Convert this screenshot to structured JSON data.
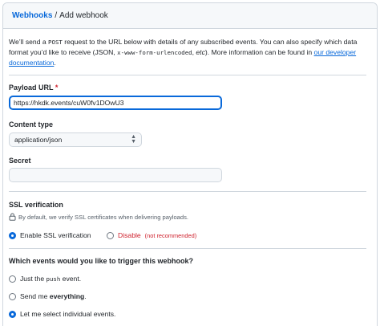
{
  "breadcrumb": {
    "parent": "Webhooks",
    "separator": "/",
    "current": "Add webhook"
  },
  "intro": {
    "t1": "We’ll send a ",
    "code_post": "POST",
    "t2": " request to the URL below with details of any subscribed events. You can also specify which data format you’d like to receive (JSON, ",
    "code_form": "x-www-form-urlencoded",
    "t3": ", ",
    "etc": "etc",
    "t4": "). More information can be found in ",
    "link": "our developer documentation",
    "t5": "."
  },
  "payload_url": {
    "label": "Payload URL",
    "required_mark": "*",
    "value": "https://hkdk.events/cuW0fv1DOwU3"
  },
  "content_type": {
    "label": "Content type",
    "selected": "application/json"
  },
  "secret": {
    "label": "Secret",
    "value": ""
  },
  "ssl": {
    "label": "SSL verification",
    "note": "By default, we verify SSL certificates when delivering payloads.",
    "enable_label": "Enable SSL verification",
    "disable_label": "Disable",
    "disable_hint": "(not recommended)",
    "selected": "enable"
  },
  "events": {
    "question": "Which events would you like to trigger this webhook?",
    "opt1_a": "Just the ",
    "opt1_code": "push",
    "opt1_b": " event.",
    "opt2_a": "Send me ",
    "opt2_bold": "everything",
    "opt2_b": ".",
    "opt3": "Let me select individual events.",
    "selected": "individual"
  },
  "colors": {
    "accent": "#0969da",
    "danger": "#cf222e",
    "border": "#d0d7de",
    "header_bg": "#f6f8fa"
  }
}
